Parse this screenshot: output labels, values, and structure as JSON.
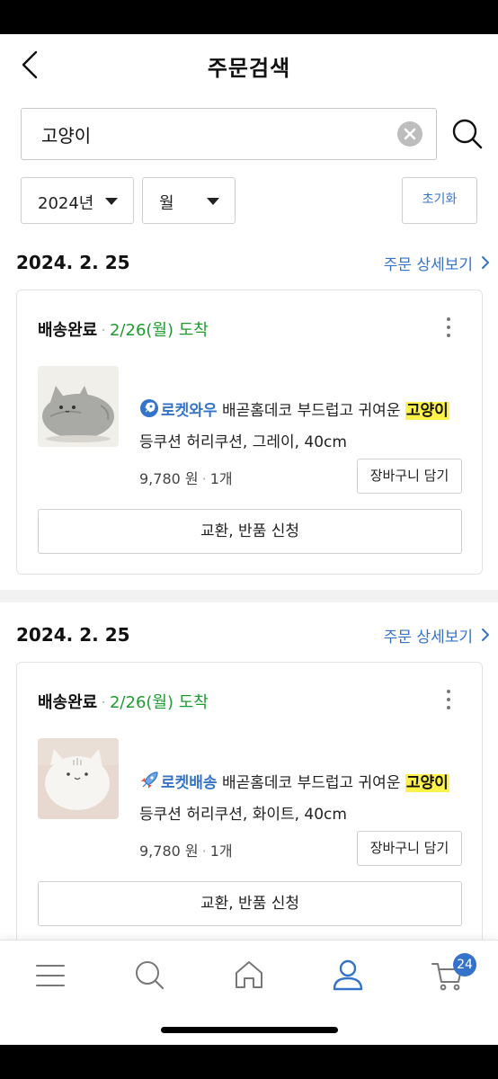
{
  "header": {
    "title": "주문검색"
  },
  "search": {
    "value": "고양이"
  },
  "filters": {
    "year": "2024년",
    "month": "월",
    "reset_label": "초기화"
  },
  "orders": [
    {
      "date": "2024. 2. 25",
      "detail_link": "주문 상세보기",
      "status": "배송완료",
      "status_sep": "·",
      "arrival": "2/26(월) 도착",
      "badge": "로켓와우",
      "badge_icon": "rocket-wow-icon",
      "name_before": "배곧홈데코 부드럽고 귀여운",
      "name_highlight": "고양이",
      "name_after": "등쿠션 허리쿠션, 그레이, 40cm",
      "price": "9,780 원",
      "qty_sep": "·",
      "qty": "1개",
      "cart_label": "장바구니 담기",
      "return_label": "교환, 반품 신청"
    },
    {
      "date": "2024. 2. 25",
      "detail_link": "주문 상세보기",
      "status": "배송완료",
      "status_sep": "·",
      "arrival": "2/26(월) 도착",
      "badge": "로켓배송",
      "badge_icon": "rocket-icon",
      "name_before": "배곧홈데코 부드럽고 귀여운",
      "name_highlight": "고양이",
      "name_after": "등쿠션 허리쿠션, 화이트, 40cm",
      "price": "9,780 원",
      "qty_sep": "·",
      "qty": "1개",
      "cart_label": "장바구니 담기",
      "return_label": "교환, 반품 신청"
    }
  ],
  "bottom_nav": {
    "items": [
      "menu-icon",
      "search-icon",
      "home-icon",
      "my-page-icon",
      "cart-icon"
    ],
    "cart_count": "24",
    "active": "my-page-icon"
  },
  "colors": {
    "accent": "#3473c9",
    "arrival_green": "#1e9c2f",
    "highlight": "#fff34a"
  }
}
